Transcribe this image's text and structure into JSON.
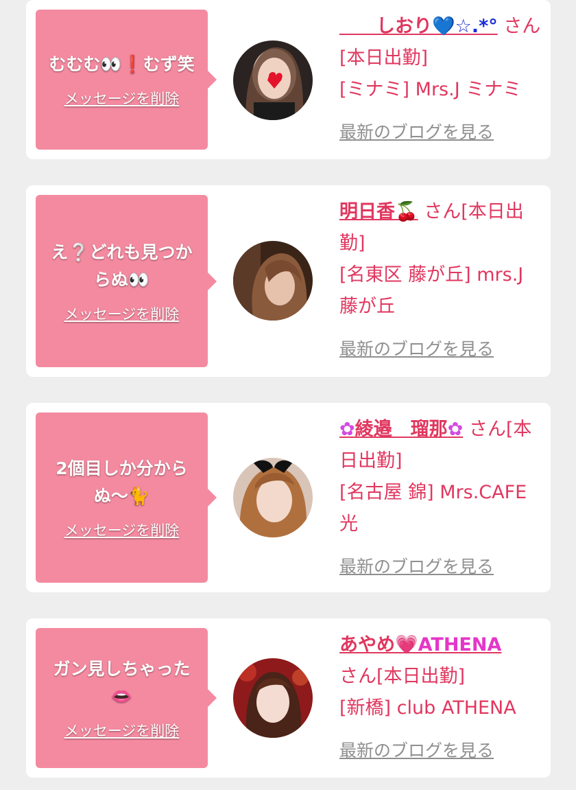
{
  "items": [
    {
      "message": "むむむ👀❗️むず笑",
      "delete_label": "メッセージを削除",
      "name_prefix": "　　",
      "name": "しおり",
      "name_suffix": "💙☆.*°",
      "after_name": " さん[本日出勤]",
      "shop": "[ミナミ] Mrs.J ミナミ",
      "blog_label": "最新のブログを見る"
    },
    {
      "message": "え❔どれも見つからぬ👀",
      "delete_label": "メッセージを削除",
      "name_prefix": "",
      "name": "明日香",
      "name_suffix": "🍒",
      "after_name": " さん[本日出勤]",
      "shop": "[名東区 藤が丘] mrs.J 藤が丘",
      "blog_label": "最新のブログを見る"
    },
    {
      "message": "2個目しか分からぬ〜🐈",
      "delete_label": "メッセージを削除",
      "name_prefix": "✿",
      "name": "綾邉　瑠那",
      "name_suffix": "✿",
      "after_name": " さん[本日出勤]",
      "shop": "[名古屋 錦] Mrs.CAFE 光",
      "blog_label": "最新のブログを見る"
    },
    {
      "message": "ガン見しちゃった 👄",
      "delete_label": "メッセージを削除",
      "name_prefix": "",
      "name": "あやめ",
      "name_suffix": "💗ATHENA",
      "after_name": " さん[本日出勤]",
      "shop": "[新橋] club ATHENA",
      "blog_label": "最新のブログを見る"
    }
  ],
  "colors": {
    "background": "#eeeeee",
    "card": "#ffffff",
    "bubble": "#f48aa0",
    "accent_text": "#e0375f",
    "link_gray": "#8f8f8f"
  }
}
